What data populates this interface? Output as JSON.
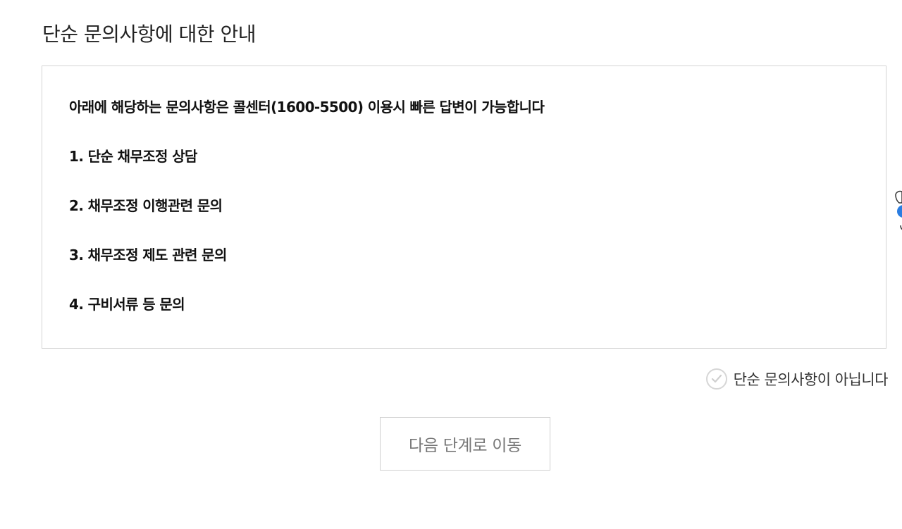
{
  "page": {
    "title": "단순 문의사항에 대한 안내"
  },
  "notice": {
    "intro": "아래에 해당하는 문의사항은 콜센터(1600-5500) 이용시 빠른 답변이 가능합니다",
    "items": [
      "1. 단순 채무조정 상담",
      "2. 채무조정 이행관련 문의",
      "3. 채무조정 제도 관련 문의",
      "4. 구비서류 등 문의"
    ]
  },
  "confirm": {
    "label": "단순 문의사항이 아닙니다",
    "checked": false
  },
  "actions": {
    "next_label": "다음 단계로 이동"
  },
  "colors": {
    "border": "#d4d4d4",
    "check_border": "#d6d6d6",
    "button_text": "#777777"
  },
  "icons": {
    "check": "checkmark-icon",
    "side_widget": "chatbot-mascot-icon"
  }
}
